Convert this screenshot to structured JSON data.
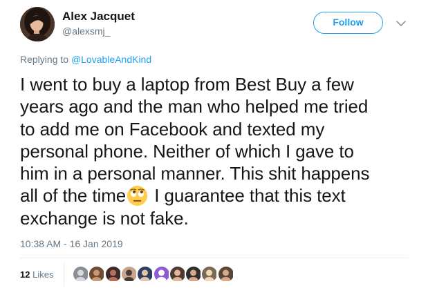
{
  "author": {
    "display_name": "Alex Jacquet",
    "handle": "@alexsmj_",
    "avatar_icon": "profile-photo-avatar"
  },
  "follow_button": {
    "label": "Follow",
    "color": "#1da1f2"
  },
  "menu_icon": "chevron-down-icon",
  "reply": {
    "prefix": "Replying to ",
    "mention": "@LovableAndKind"
  },
  "tweet": {
    "lines": [
      "I went to buy a laptop from Best Buy a few",
      "years ago and the man who helped me tried",
      "to add me on Facebook and texted my",
      "personal phone. Neither of which I gave to",
      "him in a personal manner. This shit happens"
    ],
    "line6_before_emoji": "all of the time",
    "emoji": "face-with-rolling-eyes-emoji",
    "line6_after_emoji": " I guarantee that this text",
    "line7": "exchange is not fake."
  },
  "timestamp": "10:38 AM - 16 Jan 2019",
  "likes": {
    "count": "12",
    "label": "Likes",
    "liker_avatar_count": 10
  },
  "colors": {
    "accent": "#1da1f2",
    "text": "#14171a",
    "secondary_text": "#657786",
    "divider": "#e6ecf0"
  }
}
